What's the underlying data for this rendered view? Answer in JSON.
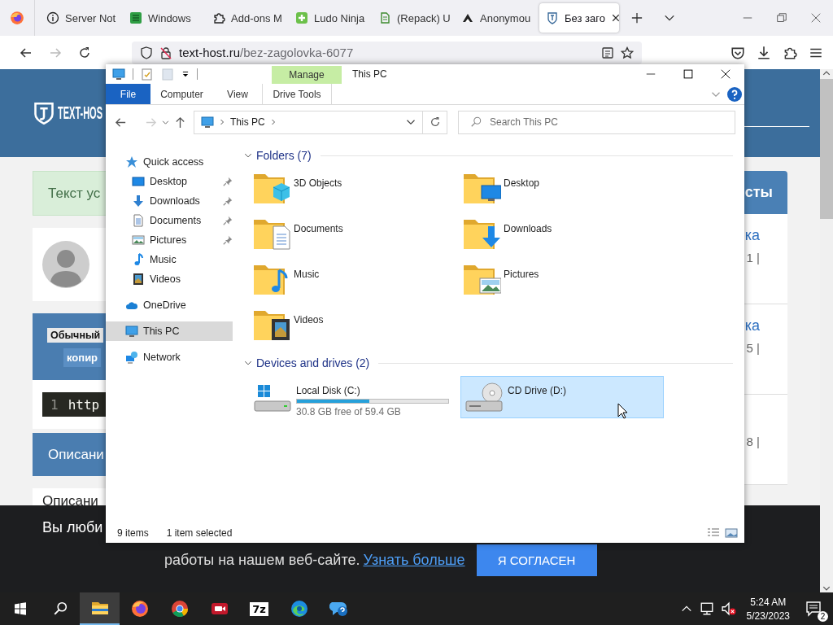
{
  "browser": {
    "tabs": [
      {
        "title": "Server Not",
        "kind": "info",
        "selected": false
      },
      {
        "title": "Windows",
        "kind": "windows",
        "selected": false
      },
      {
        "title": "Add-ons M",
        "kind": "puzzle",
        "selected": false
      },
      {
        "title": "Ludo Ninja",
        "kind": "ludo",
        "selected": false
      },
      {
        "title": "(Repack) U",
        "kind": "repack",
        "selected": false
      },
      {
        "title": "Anonymou",
        "kind": "anonymous",
        "selected": false
      },
      {
        "title": "Без заго",
        "kind": "texthost",
        "selected": true
      }
    ],
    "url": {
      "host": "text-host.ru",
      "path": "/bez-zagolovka-6077"
    }
  },
  "webpage": {
    "logo": "TEXT-HOS",
    "alert": "Текст ус",
    "format_label": "Обычный",
    "copy_button": "копир",
    "code_line_number": "1",
    "code_text": "http",
    "description_header": "Описани",
    "description_text": "Описани",
    "sidebar_header": "сты",
    "sidebar_items": [
      {
        "title": "ка",
        "meta": "1 |"
      },
      {
        "title": "ка",
        "meta": "5 |"
      },
      {
        "meta": "8 |"
      }
    ]
  },
  "cookie_banner": {
    "line_1": "Вы люби",
    "line_2": "работы на нашем веб-сайте.",
    "link": "Узнать больше",
    "button": "Я СОГЛАСЕН"
  },
  "explorer": {
    "title": "This PC",
    "context_tab": "Manage",
    "ribbon_tabs": [
      {
        "label": "File",
        "kind": "file"
      },
      {
        "label": "Computer",
        "kind": "plain"
      },
      {
        "label": "View",
        "kind": "plain"
      },
      {
        "label": "Drive Tools",
        "kind": "context"
      }
    ],
    "address": "This PC",
    "search": {
      "placeholder": "Search This PC"
    },
    "nav": [
      {
        "label": "Quick access",
        "kind": "star",
        "selected": false,
        "children": [
          {
            "label": "Desktop",
            "kind": "desktop",
            "pinned": true
          },
          {
            "label": "Downloads",
            "kind": "download",
            "pinned": true
          },
          {
            "label": "Documents",
            "kind": "document",
            "pinned": true
          },
          {
            "label": "Pictures",
            "kind": "pictures",
            "pinned": true
          },
          {
            "label": "Music",
            "kind": "music",
            "pinned": false
          },
          {
            "label": "Videos",
            "kind": "videos",
            "pinned": false
          }
        ]
      },
      {
        "label": "OneDrive",
        "kind": "cloud",
        "selected": false
      },
      {
        "label": "This PC",
        "kind": "pc",
        "selected": true
      },
      {
        "label": "Network",
        "kind": "network",
        "selected": false
      }
    ],
    "folders_header": "Folders (7)",
    "folders": [
      {
        "name": "3D Objects",
        "kind": "objects"
      },
      {
        "name": "Desktop",
        "kind": "desktop"
      },
      {
        "name": "Documents",
        "kind": "document"
      },
      {
        "name": "Downloads",
        "kind": "download"
      },
      {
        "name": "Music",
        "kind": "music"
      },
      {
        "name": "Pictures",
        "kind": "pictures"
      },
      {
        "name": "Videos",
        "kind": "videos"
      }
    ],
    "drives_header": "Devices and drives (2)",
    "drives": [
      {
        "name": "Local Disk (C:)",
        "kind": "disk",
        "level": 0.48,
        "free": "30.8 GB free of 59.4 GB",
        "selected": false
      },
      {
        "name": "CD Drive (D:)",
        "kind": "cd",
        "selected": true
      }
    ],
    "status": {
      "items": "9 items",
      "selection": "1 item selected"
    }
  },
  "taskbar": {
    "apps": [
      {
        "kind": "explorer",
        "selected": true
      },
      {
        "kind": "firefox",
        "selected": false
      },
      {
        "kind": "chrome",
        "selected": false
      },
      {
        "kind": "recorder",
        "selected": false
      },
      {
        "kind": "archiver",
        "label": "7z",
        "selected": false
      },
      {
        "kind": "edge",
        "selected": false
      },
      {
        "kind": "help",
        "selected": false
      }
    ],
    "time": "5:24 AM",
    "date": "5/23/2023",
    "notification_count": "2"
  }
}
